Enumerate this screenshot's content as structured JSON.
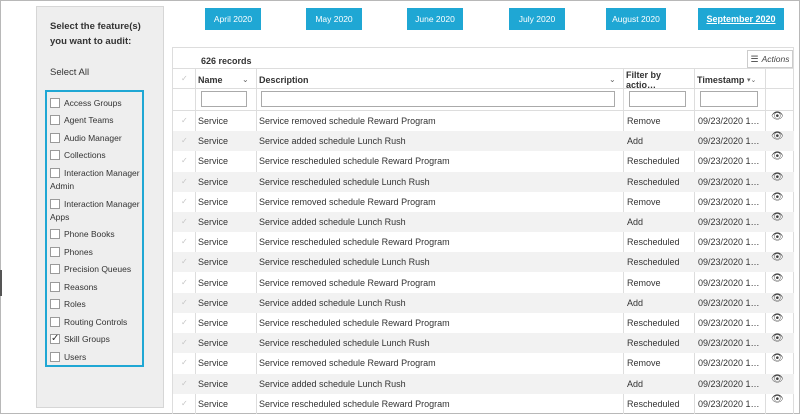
{
  "sidebar": {
    "title": "Select the feature(s) you want to audit:",
    "select_all": "Select All",
    "features": [
      {
        "label": "Access Groups",
        "checked": false
      },
      {
        "label": "Agent Teams",
        "checked": false
      },
      {
        "label": "Audio Manager",
        "checked": false
      },
      {
        "label": "Collections",
        "checked": false
      },
      {
        "label": "Interaction Manager Admin",
        "line1": "Interaction Manager",
        "line2": "Admin",
        "checked": false
      },
      {
        "label": "Interaction Manager Apps",
        "line1": "Interaction Manager",
        "line2": "Apps",
        "checked": false
      },
      {
        "label": "Phone Books",
        "checked": false
      },
      {
        "label": "Phones",
        "checked": false
      },
      {
        "label": "Precision Queues",
        "checked": false
      },
      {
        "label": "Reasons",
        "checked": false
      },
      {
        "label": "Roles",
        "checked": false
      },
      {
        "label": "Routing Controls",
        "checked": false
      },
      {
        "label": "Skill Groups",
        "checked": true
      },
      {
        "label": "Users",
        "checked": false
      }
    ]
  },
  "months": [
    {
      "label": "April 2020",
      "active": false
    },
    {
      "label": "May 2020",
      "active": false
    },
    {
      "label": "June 2020",
      "active": false
    },
    {
      "label": "July 2020",
      "active": false
    },
    {
      "label": "August 2020",
      "active": false
    },
    {
      "label": "September 2020",
      "active": true
    }
  ],
  "table": {
    "record_count": "626 records",
    "actions_label": "Actions",
    "columns": {
      "name": "Name",
      "description": "Description",
      "action": "Filter by actio…",
      "timestamp": "Timestamp"
    },
    "rows": [
      {
        "name": "Service",
        "description": "Service removed schedule Reward Program",
        "action": "Remove",
        "timestamp": "09/23/2020 1…"
      },
      {
        "name": "Service",
        "description": "Service added schedule Lunch Rush",
        "action": "Add",
        "timestamp": "09/23/2020 1…"
      },
      {
        "name": "Service",
        "description": "Service rescheduled schedule Reward Program",
        "action": "Rescheduled",
        "timestamp": "09/23/2020 1…"
      },
      {
        "name": "Service",
        "description": "Service rescheduled schedule Lunch Rush",
        "action": "Rescheduled",
        "timestamp": "09/23/2020 1…"
      },
      {
        "name": "Service",
        "description": "Service removed schedule Reward Program",
        "action": "Remove",
        "timestamp": "09/23/2020 1…"
      },
      {
        "name": "Service",
        "description": "Service added schedule Lunch Rush",
        "action": "Add",
        "timestamp": "09/23/2020 1…"
      },
      {
        "name": "Service",
        "description": "Service rescheduled schedule Reward Program",
        "action": "Rescheduled",
        "timestamp": "09/23/2020 1…"
      },
      {
        "name": "Service",
        "description": "Service rescheduled schedule Lunch Rush",
        "action": "Rescheduled",
        "timestamp": "09/23/2020 1…"
      },
      {
        "name": "Service",
        "description": "Service removed schedule Reward Program",
        "action": "Remove",
        "timestamp": "09/23/2020 1…"
      },
      {
        "name": "Service",
        "description": "Service added schedule Lunch Rush",
        "action": "Add",
        "timestamp": "09/23/2020 1…"
      },
      {
        "name": "Service",
        "description": "Service rescheduled schedule Reward Program",
        "action": "Rescheduled",
        "timestamp": "09/23/2020 1…"
      },
      {
        "name": "Service",
        "description": "Service rescheduled schedule Lunch Rush",
        "action": "Rescheduled",
        "timestamp": "09/23/2020 1…"
      },
      {
        "name": "Service",
        "description": "Service removed schedule Reward Program",
        "action": "Remove",
        "timestamp": "09/23/2020 1…"
      },
      {
        "name": "Service",
        "description": "Service added schedule Lunch Rush",
        "action": "Add",
        "timestamp": "09/23/2020 1…"
      },
      {
        "name": "Service",
        "description": "Service rescheduled schedule Reward Program",
        "action": "Rescheduled",
        "timestamp": "09/23/2020 1…"
      }
    ]
  },
  "icons": {
    "row_check": "check-icon",
    "view": "eye-icon",
    "menu": "hamburger-icon",
    "sort": "chevron-down-icon"
  },
  "colors": {
    "accent": "#1fa7d4",
    "sidebar_bg": "#eeeeee",
    "row_alt": "#f2f2f2"
  }
}
